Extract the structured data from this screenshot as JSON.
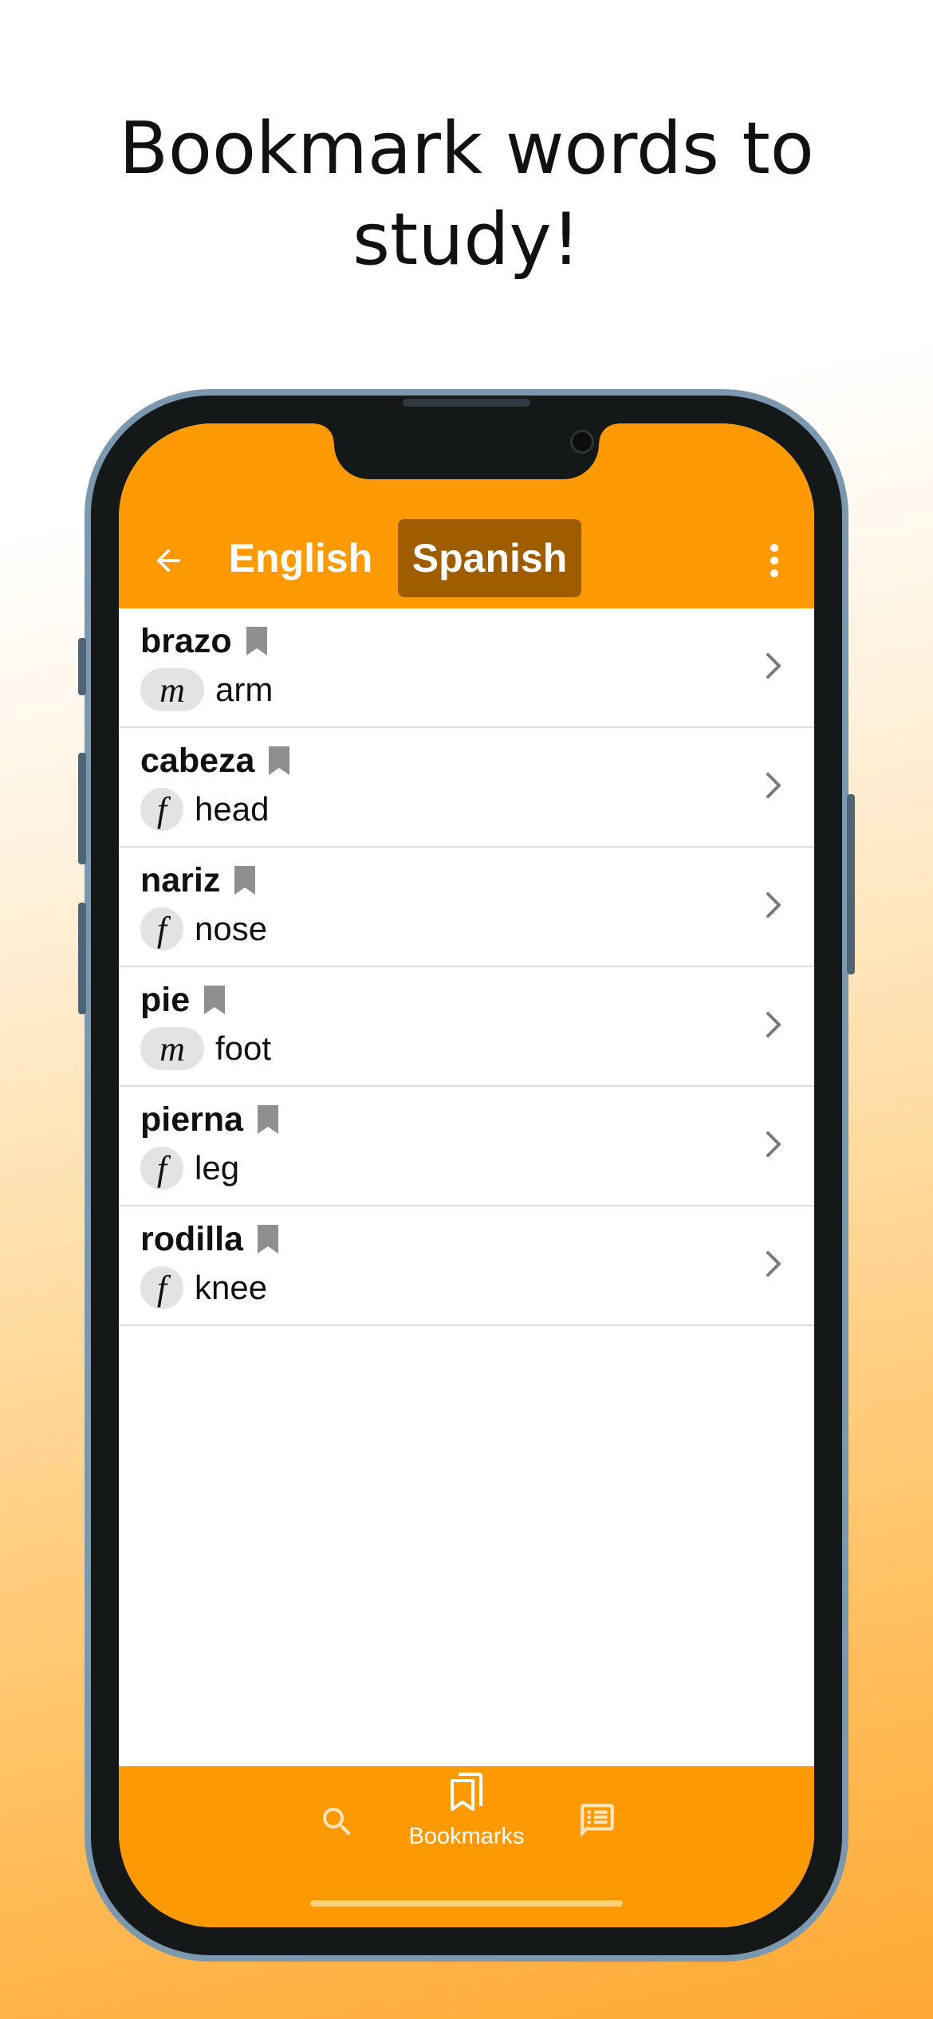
{
  "headline": {
    "line1": "Bookmark words to",
    "line2": "study!"
  },
  "app_bar": {
    "back_icon": "arrow-left-icon",
    "tabs": [
      "English",
      "Spanish"
    ],
    "selected_tab": "Spanish",
    "menu_icon": "more-vertical-icon"
  },
  "words": [
    {
      "word": "brazo",
      "gender": "m",
      "meaning": "arm"
    },
    {
      "word": "cabeza",
      "gender": "f",
      "meaning": "head"
    },
    {
      "word": "nariz",
      "gender": "f",
      "meaning": "nose"
    },
    {
      "word": "pie",
      "gender": "m",
      "meaning": "foot"
    },
    {
      "word": "pierna",
      "gender": "f",
      "meaning": "leg"
    },
    {
      "word": "rodilla",
      "gender": "f",
      "meaning": "knee"
    }
  ],
  "bottom_nav": {
    "search_icon": "search-icon",
    "bookmarks_label": "Bookmarks",
    "feed_icon": "message-list-icon"
  },
  "colors": {
    "accent": "#fd9902",
    "selected_tab_bg": "#a05d00",
    "bookmark_icon": "#8f8f8f",
    "gender_pill_bg": "#e3e3e3"
  }
}
